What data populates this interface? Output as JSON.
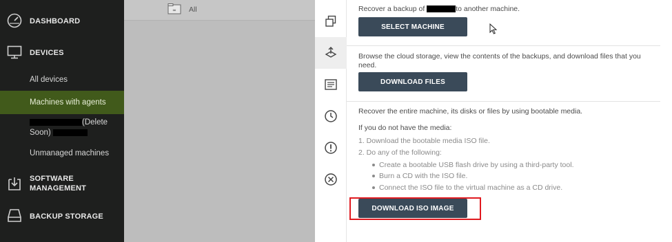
{
  "sidebar": {
    "dashboard": "DASHBOARD",
    "devices": "DEVICES",
    "all_devices": "All devices",
    "machines_with_agents": "Machines with agents",
    "redacted_item_suffix": "(Delete",
    "redacted_item_line2": "Soon)",
    "unmanaged": "Unmanaged machines",
    "software_l1": "SOFTWARE",
    "software_l2": "MANAGEMENT",
    "backup_storage": "BACKUP STORAGE"
  },
  "list_panel": {
    "filter_label": "All"
  },
  "recovery": {
    "recover_prefix": "Recover a backup of",
    "recover_suffix": "to another machine.",
    "select_machine": "SELECT MACHINE",
    "browse_text": "Browse the cloud storage, view the contents of the backups, and download files that you need.",
    "download_files": "DOWNLOAD FILES",
    "bootable_intro": "Recover the entire machine, its disks or files by using bootable media.",
    "no_media": "If you do not have the media:",
    "step1": "1. Download the bootable media ISO file.",
    "step2": "2. Do any of the following:",
    "bullets": [
      "Create a bootable USB flash drive by using a third-party tool.",
      "Burn a CD with the ISO file.",
      "Connect the ISO file to the virtual machine as a CD drive."
    ],
    "download_iso": "DOWNLOAD ISO IMAGE"
  },
  "colors": {
    "sidebar_bg": "#1e1f1e",
    "active_item_bg": "#415a1b",
    "button_bg": "#3a4a59",
    "highlight_border": "#e0191f"
  },
  "icons": {
    "rail": [
      "copy-icon",
      "recovery-icon",
      "activity-log-icon",
      "clock-icon",
      "alert-icon",
      "close-circle-icon"
    ]
  }
}
